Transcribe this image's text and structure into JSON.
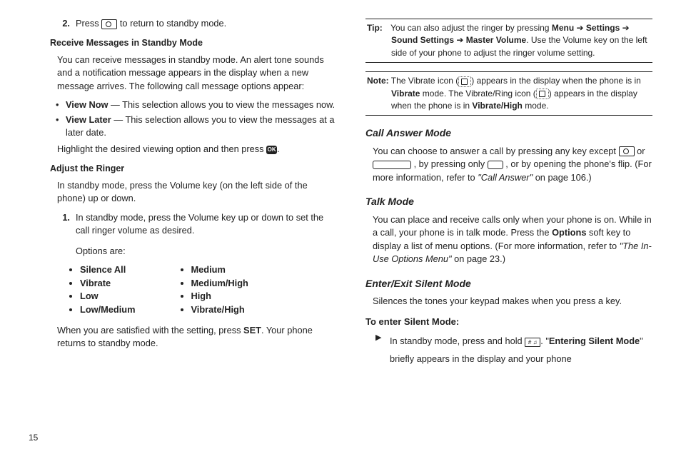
{
  "left": {
    "step2_num": "2.",
    "step2_a": "Press",
    "step2_b": "to return to standby mode.",
    "h_recv": "Receive Messages in Standby Mode",
    "recv_p": "You can receive messages in standby mode. An alert tone sounds and a notification message appears in the display when a new message arrives. The following call message options appear:",
    "recv_b1_strong": "View Now",
    "recv_b1_rest": " — This selection allows you to view the messages now.",
    "recv_b2_strong": "View Later",
    "recv_b2_rest": " — This selection allows you to view the messages at a later date.",
    "recv_p2_a": "Highlight the desired viewing option and then press ",
    "recv_p2_b": ".",
    "h_adj": "Adjust the Ringer",
    "adj_p": "In standby mode, press the Volume key (on the left side of the phone) up or down.",
    "adj_s1_num": "1.",
    "adj_s1_a": "In standby mode, press the Volume key up or down to set the call ringer volume as desired.",
    "adj_s1_b": "Options are:",
    "list_left": [
      "Silence All",
      "Vibrate",
      "Low",
      "Low/Medium"
    ],
    "list_right": [
      "Medium",
      "Medium/High",
      "High",
      "Vibrate/High"
    ],
    "adj_p2_a": "When you are satisfied with the setting, press ",
    "adj_p2_set": "SET",
    "adj_p2_b": ". Your phone returns to standby mode."
  },
  "right": {
    "tip_lead": "Tip:",
    "tip_a": " You can also adjust the ringer by pressing ",
    "tip_menu": "Menu",
    "tip_arrow": " ➔ ",
    "tip_settings": "Settings",
    "tip_sound": "Sound Settings",
    "tip_master": "Master Volume",
    "tip_b": ". Use the Volume key on the left side of your phone to adjust the ringer volume setting.",
    "note_lead": "Note:",
    "note_a": " The Vibrate icon (",
    "note_b": ") appears in the display when the phone is in ",
    "note_vib": "Vibrate",
    "note_c": " mode. The Vibrate/Ring icon (",
    "note_d": ") appears in the display when the phone is in ",
    "note_vh": "Vibrate/High",
    "note_e": " mode.",
    "h_call": "Call Answer Mode",
    "call_a": "You can choose to answer a call by pressing any key except ",
    "call_b": " or ",
    "call_c": ", by pressing only ",
    "call_d": ", or by opening the phone's flip. (For more information, refer to ",
    "call_ref": "\"Call Answer\"",
    "call_e": "  on page 106.)",
    "h_talk": "Talk Mode",
    "talk_a": "You can place and receive calls only when your phone is on. While in a call, your phone is in talk mode. Press the ",
    "talk_opt": "Options",
    "talk_b": " soft key to display a list of menu options. (For more information, refer to ",
    "talk_ref": "\"The In-Use Options Menu\"",
    "talk_c": "  on page 23.)",
    "h_silent": "Enter/Exit Silent Mode",
    "silent_p": "Silences the tones your keypad makes when you press a key.",
    "h_tos": "To enter Silent Mode:",
    "tos_a": "In standby mode, press and hold ",
    "tos_b": ". \"",
    "tos_strong": "Entering Silent Mode",
    "tos_c": "\" briefly appears in the display and your phone"
  },
  "page_number": "15",
  "icons": {
    "ok_label": "OK",
    "hash_label": "# ♫"
  }
}
